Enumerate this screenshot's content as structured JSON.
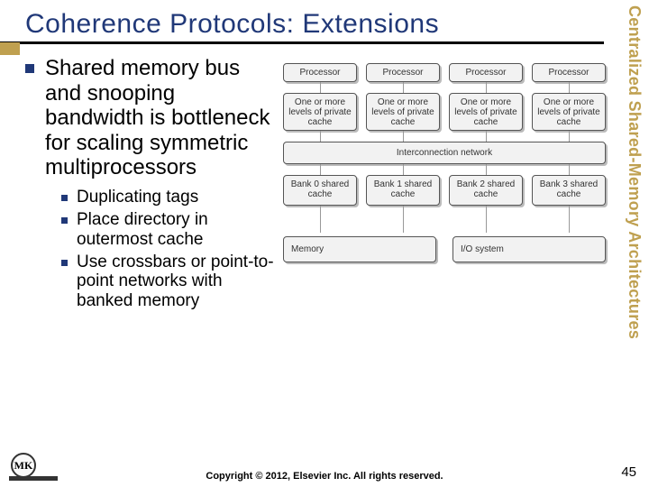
{
  "title": "Coherence Protocols:  Extensions",
  "side_label": "Centralized Shared-Memory Architectures",
  "main_bullet": "Shared memory bus and snooping bandwidth is bottleneck for scaling symmetric multiprocessors",
  "sub_bullets": [
    "Duplicating tags",
    "Place directory in outermost cache",
    "Use crossbars or point-to-point networks with banked memory"
  ],
  "diagram": {
    "processor": "Processor",
    "cache": "One or more levels of private cache",
    "interconnect": "Interconnection network",
    "banks": [
      "Bank 0 shared cache",
      "Bank 1 shared cache",
      "Bank 2 shared cache",
      "Bank 3 shared cache"
    ],
    "memory": "Memory",
    "io": "I/O system"
  },
  "footer": "Copyright © 2012, Elsevier Inc. All rights reserved.",
  "page": "45",
  "logo_text": "MK"
}
